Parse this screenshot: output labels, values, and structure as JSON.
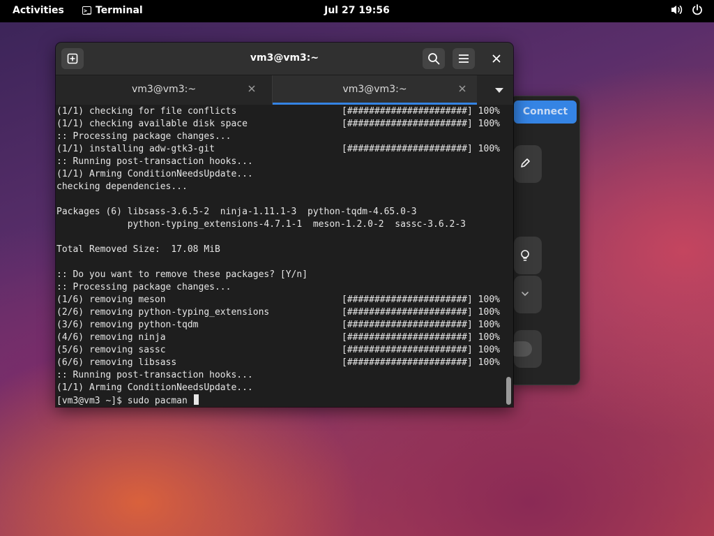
{
  "topbar": {
    "activities": "Activities",
    "app_name": "Terminal",
    "clock": "Jul 27  19:56",
    "icons": [
      "volume-icon",
      "power-icon"
    ]
  },
  "background_dialog": {
    "connect_label": "Connect",
    "icons": [
      "pencil-icon",
      "lightbulb-icon",
      "chevron-down-icon",
      "toggle-switch"
    ]
  },
  "terminal": {
    "title": "vm3@vm3:~",
    "buttons": [
      "new-tab-icon",
      "search-icon",
      "menu-icon",
      "close-icon"
    ],
    "tabs": [
      {
        "label": "vm3@vm3:~",
        "active": false
      },
      {
        "label": "vm3@vm3:~",
        "active": true
      }
    ],
    "lines": [
      {
        "left": "(1/1) checking for file conflicts",
        "right": "[######################] 100%"
      },
      {
        "left": "(1/1) checking available disk space",
        "right": "[######################] 100%"
      },
      {
        "left": ":: Processing package changes...",
        "right": ""
      },
      {
        "left": "(1/1) installing adw-gtk3-git",
        "right": "[######################] 100%"
      },
      {
        "left": ":: Running post-transaction hooks...",
        "right": ""
      },
      {
        "left": "(1/1) Arming ConditionNeedsUpdate...",
        "right": ""
      },
      {
        "left": "checking dependencies...",
        "right": ""
      },
      {
        "left": "",
        "right": ""
      },
      {
        "left": "Packages (6) libsass-3.6.5-2  ninja-1.11.1-3  python-tqdm-4.65.0-3",
        "right": ""
      },
      {
        "left": "             python-typing_extensions-4.7.1-1  meson-1.2.0-2  sassc-3.6.2-3",
        "right": ""
      },
      {
        "left": "",
        "right": ""
      },
      {
        "left": "Total Removed Size:  17.08 MiB",
        "right": ""
      },
      {
        "left": "",
        "right": ""
      },
      {
        "left": ":: Do you want to remove these packages? [Y/n]",
        "right": ""
      },
      {
        "left": ":: Processing package changes...",
        "right": ""
      },
      {
        "left": "(1/6) removing meson",
        "right": "[######################] 100%"
      },
      {
        "left": "(2/6) removing python-typing_extensions",
        "right": "[######################] 100%"
      },
      {
        "left": "(3/6) removing python-tqdm",
        "right": "[######################] 100%"
      },
      {
        "left": "(4/6) removing ninja",
        "right": "[######################] 100%"
      },
      {
        "left": "(5/6) removing sassc",
        "right": "[######################] 100%"
      },
      {
        "left": "(6/6) removing libsass",
        "right": "[######################] 100%"
      },
      {
        "left": ":: Running post-transaction hooks...",
        "right": ""
      },
      {
        "left": "(1/1) Arming ConditionNeedsUpdate...",
        "right": ""
      }
    ],
    "prompt": "[vm3@vm3 ~]$ sudo pacman "
  }
}
